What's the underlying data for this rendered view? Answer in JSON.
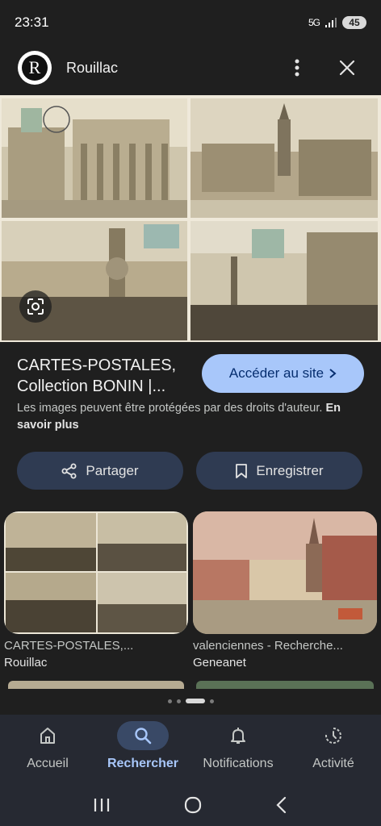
{
  "status_bar": {
    "time": "23:31",
    "network": "5G",
    "battery": "45"
  },
  "header": {
    "site_name": "Rouillac",
    "logo_letter": "R"
  },
  "result": {
    "title_line1": "CARTES-POSTALES,",
    "title_line2": "Collection BONIN |...",
    "visit_label": "Accéder au site",
    "notice_text": "Les images peuvent être protégées par des droits d'auteur.",
    "notice_link": "En savoir plus"
  },
  "actions": {
    "share_label": "Partager",
    "save_label": "Enregistrer"
  },
  "related": [
    {
      "title": "CARTES-POSTALES,...",
      "source": "Rouillac"
    },
    {
      "title": "valenciennes - Recherche...",
      "source": "Geneanet"
    }
  ],
  "bottom_nav": [
    {
      "label": "Accueil",
      "icon": "home-icon",
      "active": false
    },
    {
      "label": "Rechercher",
      "icon": "search-icon",
      "active": true
    },
    {
      "label": "Notifications",
      "icon": "bell-icon",
      "active": false
    },
    {
      "label": "Activité",
      "icon": "history-icon",
      "active": false
    }
  ],
  "colors": {
    "background": "#1f1f1f",
    "accent_button": "#a8c7fa",
    "action_button": "#2f3b52",
    "nav_active": "#394966"
  }
}
